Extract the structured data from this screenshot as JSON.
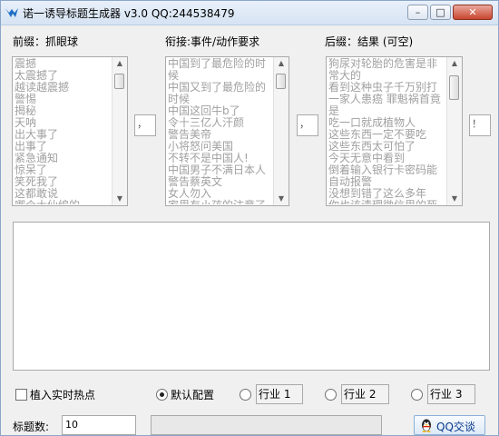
{
  "window": {
    "title": "诺一诱导标题生成器 v3.0 QQ:244538479",
    "minimize_glyph": "–",
    "maximize_glyph": "□",
    "close_glyph": "✕"
  },
  "prefix": {
    "label": "前缀：抓眼球",
    "items": [
      "震撼",
      "太震撼了",
      "越读越震撼",
      "警惕",
      "揭秘",
      "天呐",
      "出大事了",
      "出事了",
      "紧急通知",
      "惊呆了",
      "笑死我了",
      "这都敢说",
      "哪个大仙编的"
    ],
    "separator": "，"
  },
  "middle": {
    "label": "衔接:事件/动作要求",
    "items": [
      "中国到了最危险的时",
      "候",
      "中国又到了最危险的",
      "时候",
      "中国这回牛b了",
      "令十三亿人汗颜",
      "警告美帝",
      "小将怒问美国",
      "不转不是中国人!",
      "中国男子不满日本人",
      "警告蔡英文",
      "女人勿入",
      "家里有小孩的注意了"
    ],
    "separator": "，"
  },
  "suffix": {
    "label": "后缀：结果 (可空)",
    "items": [
      "狗尿对轮胎的危害是非",
      "常大的",
      "看到这种虫子千万别打",
      "一家人患癌 罪魁祸首竟",
      "是",
      "吃一口就成植物人",
      "这些东西一定不要吃",
      "这些东西太可怕了",
      "今天无意中看到",
      "倒着输入银行卡密码能",
      "自动报警",
      "没想到错了这么多年",
      "你也该清理微信里的死"
    ],
    "separator": "！"
  },
  "options": {
    "realtime_hotspot_label": "植入实时热点",
    "default_config_label": "默认配置",
    "industry_1_label": "行业 1",
    "industry_2_label": "行业 2",
    "industry_3_label": "行业 3"
  },
  "footer": {
    "count_label": "标题数:",
    "count_value": "10",
    "progress": 0,
    "qq_button_label": "QQ交谈"
  },
  "colors": {
    "titlebar": "#d6e3f3",
    "list_text": "#a0a0a0",
    "accent": "#0b3b8c"
  }
}
